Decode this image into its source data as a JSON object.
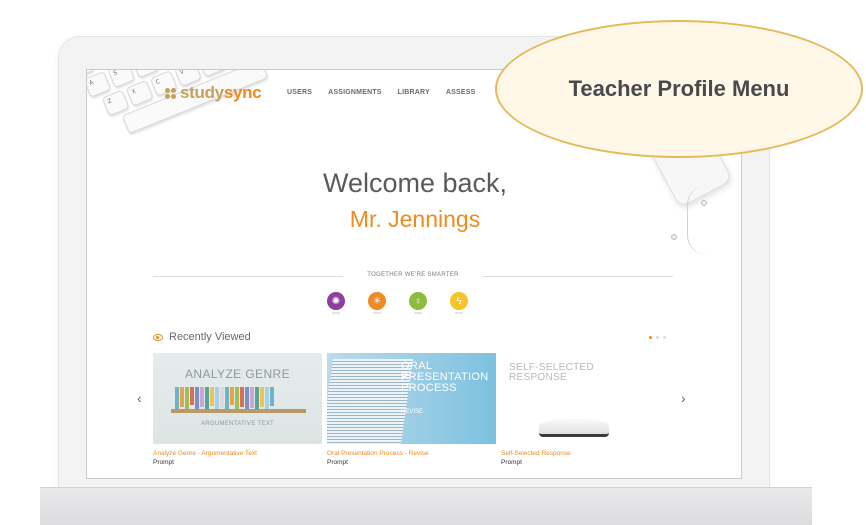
{
  "header": {
    "logo_study": "study",
    "logo_sync": "sync",
    "nav": [
      {
        "label": "USERS"
      },
      {
        "label": "ASSIGNMENTS"
      },
      {
        "label": "LIBRARY"
      },
      {
        "label": "ASSESS"
      }
    ]
  },
  "welcome": {
    "greeting": "Welcome back,",
    "name": "Mr. Jennings"
  },
  "together": {
    "label": "TOGETHER WE'RE SMARTER",
    "badges": [
      {
        "icon": "starburst-icon",
        "color": "#8e3f9e",
        "glyph": "✺"
      },
      {
        "icon": "sun-icon",
        "color": "#f08a24",
        "glyph": "☀"
      },
      {
        "icon": "lightbulb-icon",
        "color": "#8dbb3e",
        "glyph": "♀"
      },
      {
        "icon": "lightning-icon",
        "color": "#f4c42a",
        "glyph": "ϟ"
      }
    ]
  },
  "recent": {
    "title": "Recently Viewed",
    "pages": 3,
    "active_page": 1,
    "prev_arrow": "‹",
    "next_arrow": "›",
    "cards": [
      {
        "title": "Analyze Genre - Argumentative Text",
        "type": "Prompt",
        "thumb_main": "ANALYZE GENRE",
        "thumb_sub": "ARGUMENTATIVE TEXT"
      },
      {
        "title": "Oral Presentation Process - Revise",
        "type": "Prompt",
        "thumb_main_1": "ORAL",
        "thumb_main_2": "PRESENTATION",
        "thumb_main_3": "PROCESS",
        "thumb_sub": "REVISE"
      },
      {
        "title": "Self-Selected Response",
        "type": "Prompt",
        "thumb_main_1": "SELF-SELECTED",
        "thumb_main_2": "RESPONSE"
      }
    ]
  },
  "callout": {
    "text": "Teacher Profile Menu"
  },
  "colors": {
    "accent": "#ee8a1f",
    "logo_gold": "#c6a15b",
    "callout_border": "#e6b95a"
  }
}
